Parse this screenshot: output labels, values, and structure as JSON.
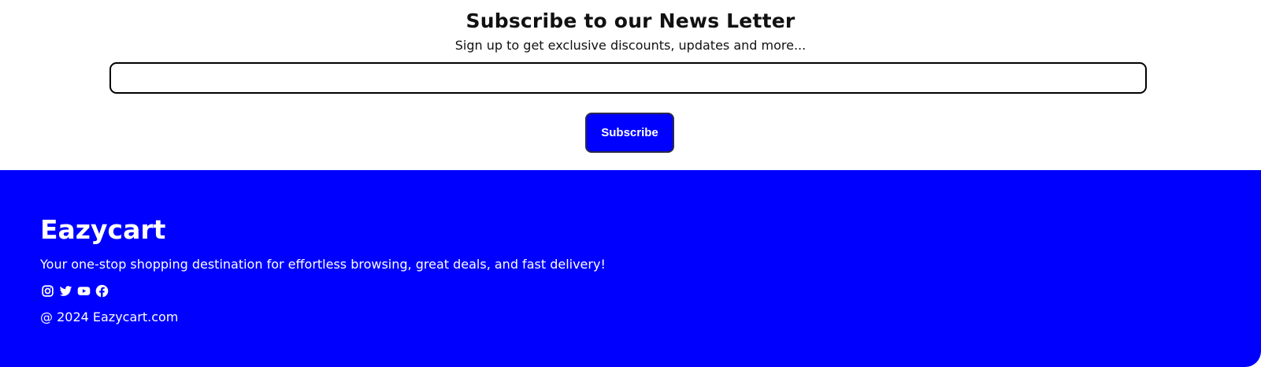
{
  "newsletter": {
    "title": "Subscribe to our News Letter",
    "subtitle": "Sign up to get exclusive discounts, updates and more...",
    "email_value": "",
    "subscribe_label": "Subscribe"
  },
  "footer": {
    "brand": "Eazycart",
    "tagline": "Your one-stop shopping destination for effortless browsing, great deals, and fast delivery!",
    "socials": [
      "instagram-icon",
      "twitter-icon",
      "youtube-icon",
      "facebook-icon"
    ],
    "copyright": "@ 2024 Eazycart.com"
  },
  "colors": {
    "accent": "#0000ff",
    "text_dark": "#111111",
    "text_light": "#ffffff"
  }
}
